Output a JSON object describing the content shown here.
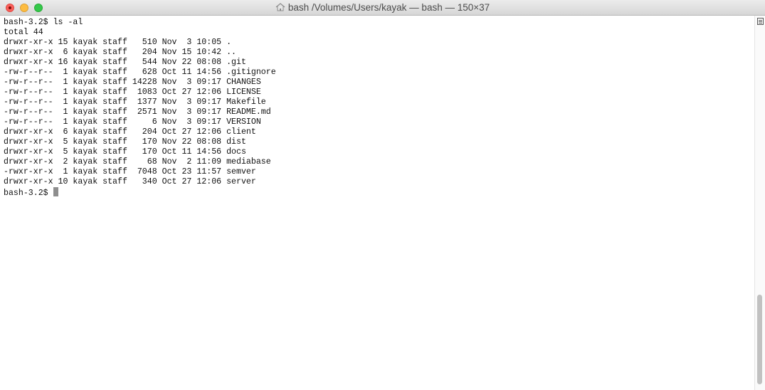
{
  "window": {
    "title": "bash  /Volumes/Users/kayak — bash — 150×37",
    "title_icon": "home-folder-icon"
  },
  "terminal": {
    "lines": [
      "bash-3.2$ ls -al",
      "total 44",
      "drwxr-xr-x 15 kayak staff   510 Nov  3 10:05 .",
      "drwxr-xr-x  6 kayak staff   204 Nov 15 10:42 ..",
      "drwxr-xr-x 16 kayak staff   544 Nov 22 08:08 .git",
      "-rw-r--r--  1 kayak staff   628 Oct 11 14:56 .gitignore",
      "-rw-r--r--  1 kayak staff 14228 Nov  3 09:17 CHANGES",
      "-rw-r--r--  1 kayak staff  1083 Oct 27 12:06 LICENSE",
      "-rw-r--r--  1 kayak staff  1377 Nov  3 09:17 Makefile",
      "-rw-r--r--  1 kayak staff  2571 Nov  3 09:17 README.md",
      "-rw-r--r--  1 kayak staff     6 Nov  3 09:17 VERSION",
      "drwxr-xr-x  6 kayak staff   204 Oct 27 12:06 client",
      "drwxr-xr-x  5 kayak staff   170 Nov 22 08:08 dist",
      "drwxr-xr-x  5 kayak staff   170 Oct 11 14:56 docs",
      "drwxr-xr-x  2 kayak staff    68 Nov  2 11:09 mediabase",
      "-rwxr-xr-x  1 kayak staff  7048 Oct 23 11:57 semver",
      "drwxr-xr-x 10 kayak staff   340 Oct 27 12:06 server"
    ],
    "prompt": "bash-3.2$ "
  },
  "colors": {
    "background": "#ffffff",
    "text": "#111111",
    "cursor": "#8e8e8e",
    "close": "#fc605b",
    "minimize": "#fdbc40",
    "maximize": "#34c84a"
  }
}
